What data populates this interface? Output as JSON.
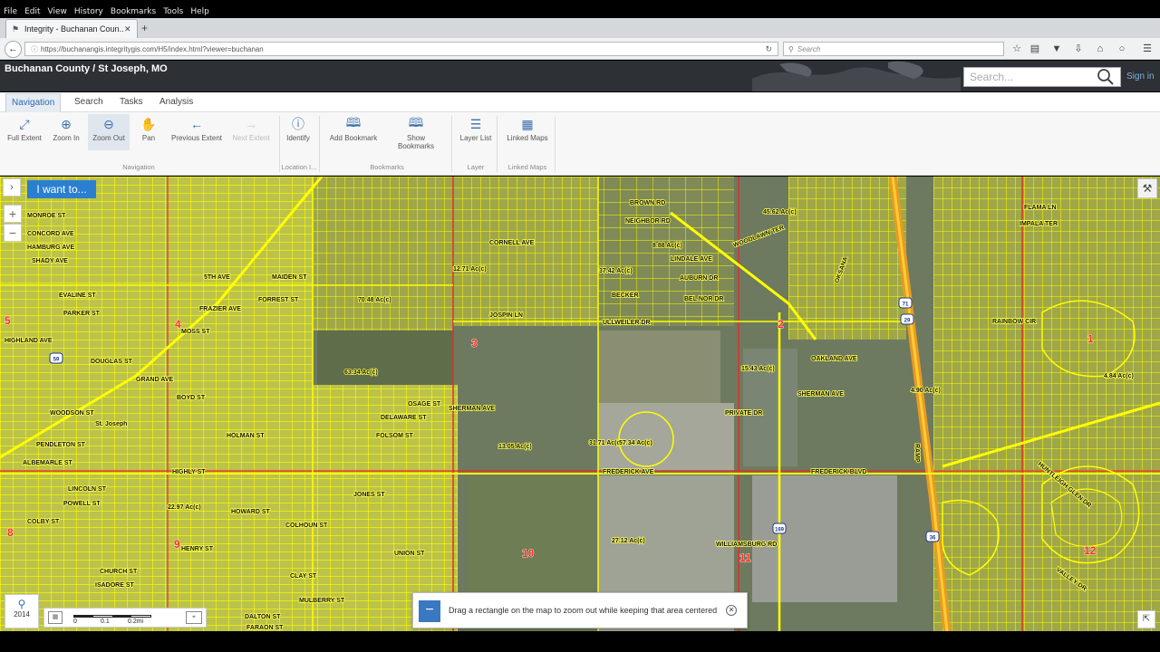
{
  "browser": {
    "menu": [
      "File",
      "Edit",
      "View",
      "History",
      "Bookmarks",
      "Tools",
      "Help"
    ],
    "tab_title": "Integrity - Buchanan Coun...",
    "url": "https://buchanangis.integritygis.com/H5/index.html?viewer=buchanan",
    "search_placeholder": "Search",
    "toolbar_icons": [
      "star-icon",
      "library-icon",
      "pocket-icon",
      "download-icon",
      "home-icon",
      "chat-icon",
      "menu-icon"
    ]
  },
  "app": {
    "title": "Buchanan County / St Joseph, MO",
    "search_placeholder": "Search...",
    "sign_in": "Sign in"
  },
  "ribbon": {
    "tabs": [
      {
        "label": "Navigation",
        "active": true
      },
      {
        "label": "Search",
        "active": false
      },
      {
        "label": "Tasks",
        "active": false
      },
      {
        "label": "Analysis",
        "active": false
      }
    ],
    "buttons": {
      "full_extent": "Full Extent",
      "zoom_in": "Zoom In",
      "zoom_out": "Zoom Out",
      "pan": "Pan",
      "previous_extent": "Previous Extent",
      "next_extent": "Next Extent",
      "identify": "Identify",
      "add_bookmark": "Add Bookmark",
      "show_bookmarks": "Show Bookmarks",
      "layer_list": "Layer List",
      "linked_maps": "Linked Maps"
    },
    "groups": {
      "navigation": "Navigation",
      "location": "Location I...",
      "bookmarks": "Bookmarks",
      "layer": "Layer",
      "linked_maps": "Linked Maps"
    }
  },
  "map": {
    "i_want_to": "I want to...",
    "zoom_in_symbol": "+",
    "zoom_out_symbol": "−",
    "year": "2014",
    "scale_labels": [
      "0",
      "0.1",
      "0.2mi"
    ],
    "tooltip": "Drag a rectangle on the map to zoom out while keeping that area centered",
    "colors": {
      "parcel": "#ffff00",
      "aerial": "#6f7c62",
      "district_label": "#ff2a1a",
      "accent": "#2b7fd0"
    },
    "street_labels": [
      "MONROE ST",
      "CONCORD AVE",
      "HAMBURG AVE",
      "SHADY AVE",
      "EVALINE ST",
      "PARKER ST",
      "HIGHLAND AVE",
      "DOUGLAS ST",
      "GRAND AVE",
      "BOYD ST",
      "WOODSON ST",
      "PENDLETON ST",
      "ALBEMARLE ST",
      "LINCOLN ST",
      "POWELL ST",
      "COLBY ST",
      "HENRY ST",
      "CHURCH ST",
      "ISADORE ST",
      "MULBERRY ST",
      "DALTON ST",
      "FARAON ST",
      "HIGHLY ST",
      "JONES ST",
      "HOWARD ST",
      "COLHOUN ST",
      "CLAY ST",
      "UNION ST",
      "OSAGE ST",
      "SHERMAN AVE",
      "DELAWARE ST",
      "FOLSOM ST",
      "HOLMAN ST",
      "MAIDEN ST",
      "FORREST ST",
      "FRAZIER AVE",
      "5TH AVE",
      "MOSS ST",
      "CORNELL AVE",
      "BROWN RD",
      "NEIGHBOR RD",
      "LINDALE AVE",
      "AUBURN DR",
      "BECKER",
      "JOSPIN LN",
      "BEL NOR DR",
      "ULLWEILER DR",
      "PRIVATE DR",
      "OAKLAND AVE",
      "SHERMAN AVE",
      "FREDERICK AVE",
      "FREDERICK BLVD",
      "WILLIAMSBURG RD",
      "WOODLAWN TER",
      "RAINBOW CIR",
      "FLAMA LN",
      "IMPALA TER",
      "HUNTLEIGH GLEN DR",
      "VALLEY DR",
      "RAMP",
      "OKSANA",
      "St. Joseph"
    ],
    "parcel_labels": [
      "70.48 Ac(c)",
      "63.34 Ac(c)",
      "31.71 Ac(c)",
      "12.71 Ac(c)",
      "37.42 Ac(c)",
      "8.88 Ac(c)",
      "4.84 Ac(c)",
      "57.34 Ac(c)",
      "45.62 Ac(c)",
      "13.05 Ac(c)",
      "27.12 Ac(c)",
      "22.97 Ac(c)",
      "15.43 Ac(c)",
      "4.90 Ac(c)"
    ],
    "district_numbers": [
      "1",
      "2",
      "3",
      "4",
      "5",
      "8",
      "9",
      "10",
      "11",
      "12"
    ],
    "route_shields": [
      "59",
      "29",
      "71",
      "169",
      "36"
    ]
  }
}
